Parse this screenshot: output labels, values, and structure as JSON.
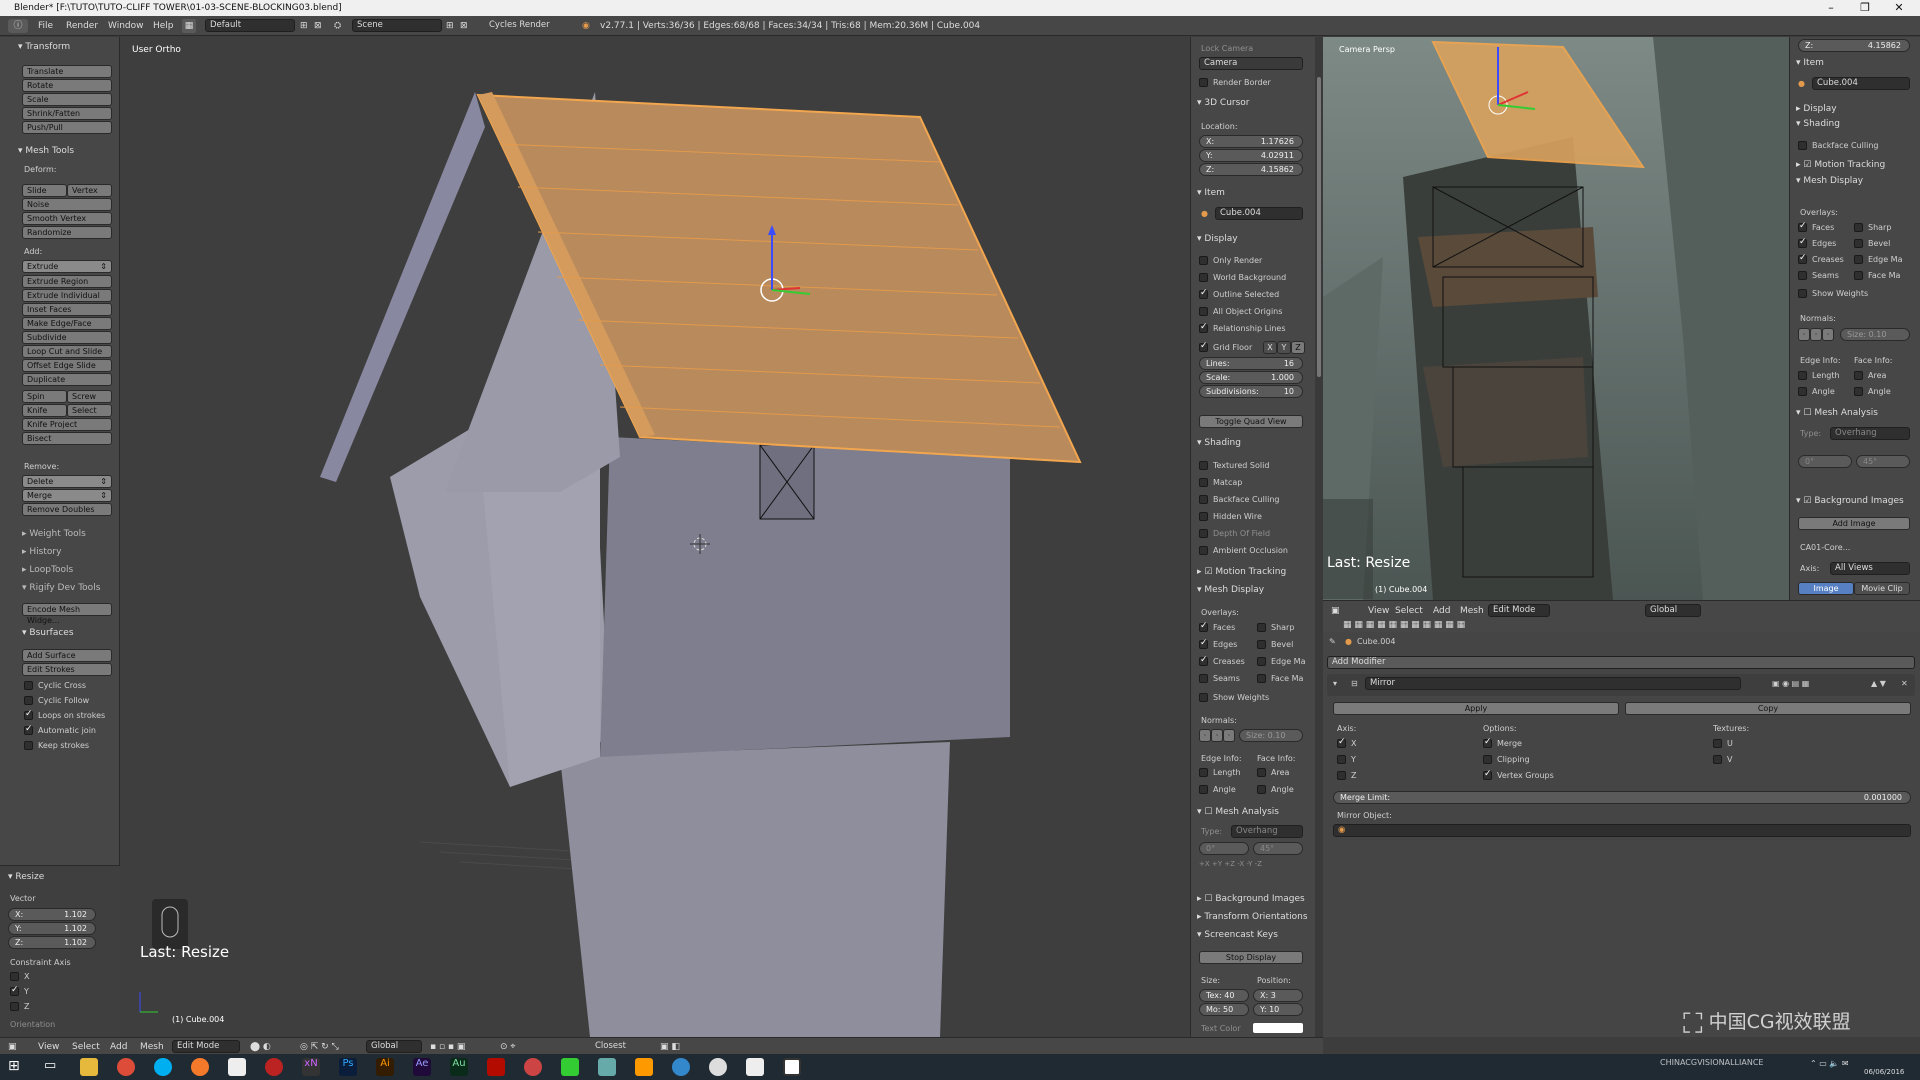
{
  "window": {
    "title": "Blender* [F:\\TUTO\\TUTO-CLIFF TOWER\\01-03-SCENE-BLOCKING03.blend]",
    "minimize": "–",
    "maximize": "❐",
    "close": "✕"
  },
  "menu": {
    "items": [
      "File",
      "Render",
      "Window",
      "Help"
    ],
    "layout": "Default",
    "scene": "Scene",
    "engine": "Cycles Render",
    "stats": "v2.77.1 | Verts:36/36 | Edges:68/68 | Faces:34/34 | Tris:68 | Mem:20.36M | Cube.004"
  },
  "toolshelf": {
    "transform_head": "Transform",
    "transform_buttons": [
      "Translate",
      "Rotate",
      "Scale",
      "Shrink/Fatten",
      "Push/Pull"
    ],
    "mesh_tools_head": "Mesh Tools",
    "deform_label": "Deform:",
    "slide_edge": "Slide Edge",
    "vertex": "Vertex",
    "deform_buttons": [
      "Noise",
      "Smooth Vertex",
      "Randomize"
    ],
    "add_label": "Add:",
    "extrude": "Extrude",
    "add_buttons": [
      "Extrude Region",
      "Extrude Individual",
      "Inset Faces",
      "Make Edge/Face",
      "Subdivide",
      "Loop Cut and Slide",
      "Offset Edge Slide",
      "Duplicate"
    ],
    "spin": "Spin",
    "screw": "Screw",
    "knife": "Knife",
    "select": "Select",
    "knife_project": "Knife Project",
    "bisect": "Bisect",
    "remove_label": "Remove:",
    "delete": "Delete",
    "merge": "Merge",
    "remove_doubles": "Remove Doubles",
    "collapsed": [
      "Weight Tools",
      "History",
      "LoopTools"
    ],
    "rigify_head": "Rigify Dev Tools",
    "encode_mesh": "Encode Mesh Widge...",
    "bsurfaces_head": "Bsurfaces",
    "add_surface": "Add Surface",
    "edit_strokes": "Edit Strokes",
    "bs_checks": [
      {
        "label": "Cyclic Cross",
        "on": false
      },
      {
        "label": "Cyclic Follow",
        "on": false
      },
      {
        "label": "Loops on strokes",
        "on": true
      },
      {
        "label": "Automatic join",
        "on": true
      },
      {
        "label": "Keep strokes",
        "on": false
      }
    ],
    "resize_head": "Resize",
    "vector_label": "Vector",
    "vector": [
      {
        "axis": "X:",
        "value": "1.102"
      },
      {
        "axis": "Y:",
        "value": "1.102"
      },
      {
        "axis": "Z:",
        "value": "1.102"
      }
    ],
    "constraint_label": "Constraint Axis",
    "constraint": [
      {
        "axis": "X",
        "on": false
      },
      {
        "axis": "Y",
        "on": true
      },
      {
        "axis": "Z",
        "on": false
      }
    ],
    "orientation_label": "Orientation"
  },
  "viewport": {
    "view_label": "User Ortho",
    "last_op": "Last: Resize",
    "object_label": "(1) Cube.004"
  },
  "npanel": {
    "lock_camera": "Lock Camera",
    "camera": "Camera",
    "render_border": "Render Border",
    "cursor_head": "3D Cursor",
    "location_label": "Location:",
    "cursor": [
      {
        "axis": "X:",
        "value": "1.17626"
      },
      {
        "axis": "Y:",
        "value": "4.02911"
      },
      {
        "axis": "Z:",
        "value": "4.15862"
      }
    ],
    "item_head": "Item",
    "item_name": "Cube.004",
    "display_head": "Display",
    "display_checks": [
      {
        "label": "Only Render",
        "on": false
      },
      {
        "label": "World Background",
        "on": false
      },
      {
        "label": "Outline Selected",
        "on": true
      },
      {
        "label": "All Object Origins",
        "on": false
      },
      {
        "label": "Relationship Lines",
        "on": true
      }
    ],
    "grid_floor": "Grid Floor",
    "grid_axes": [
      "X",
      "Y",
      "Z"
    ],
    "grid_fields": [
      {
        "label": "Lines:",
        "value": "16"
      },
      {
        "label": "Scale:",
        "value": "1.000"
      },
      {
        "label": "Subdivisions:",
        "value": "10"
      }
    ],
    "toggle_quad": "Toggle Quad View",
    "shading_head": "Shading",
    "shading_checks": [
      {
        "label": "Textured Solid",
        "on": false
      },
      {
        "label": "Matcap",
        "on": false
      },
      {
        "label": "Backface Culling",
        "on": false
      },
      {
        "label": "Hidden Wire",
        "on": false
      },
      {
        "label": "Depth Of Field",
        "on": false
      },
      {
        "label": "Ambient Occlusion",
        "on": false
      }
    ],
    "motion_tracking": "Motion Tracking",
    "mesh_display_head": "Mesh Display",
    "overlays_label": "Overlays:",
    "overlays": [
      {
        "label": "Faces",
        "on": true
      },
      {
        "label": "Sharp",
        "on": false
      },
      {
        "label": "Edges",
        "on": true
      },
      {
        "label": "Bevel",
        "on": false
      },
      {
        "label": "Creases",
        "on": true
      },
      {
        "label": "Edge Ma",
        "on": false
      },
      {
        "label": "Seams",
        "on": false
      },
      {
        "label": "Face Ma",
        "on": false
      }
    ],
    "show_weights": "Show Weights",
    "normals_label": "Normals:",
    "normals_size": "Size: 0.10",
    "edge_info": "Edge Info:",
    "face_info": "Face Info:",
    "info_checks": [
      {
        "label": "Length"
      },
      {
        "label": "Area"
      },
      {
        "label": "Angle"
      },
      {
        "label": "Angle"
      }
    ],
    "mesh_analysis": "Mesh Analysis",
    "ma_type_label": "Type:",
    "ma_type": "Overhang",
    "ma_min": "0°",
    "ma_max": "45°",
    "axis_buttons": [
      "+X",
      "+Y",
      "+Z",
      "-X",
      "-Y",
      "-Z"
    ],
    "bg_images": "Background Images",
    "transform_orient": "Transform Orientations",
    "screencast": "Screencast Keys",
    "stop_display": "Stop Display",
    "size_label": "Size:",
    "position_label": "Position:",
    "tex_field": "Tex: 40",
    "mo_field": "Mo: 50",
    "pos_x": "X: 3",
    "pos_y": "Y: 10",
    "text_color": "Text Color"
  },
  "camview": {
    "label": "Camera Persp",
    "last_op": "Last: Resize",
    "object_label": "(1) Cube.004"
  },
  "rpanel": {
    "z_field": "Z:",
    "z_value": "4.15862",
    "item_head": "Item",
    "item_name": "Cube.004",
    "display_head": "Display",
    "shading_head": "Shading",
    "backface": "Backface Culling",
    "motion_tracking": "Motion Tracking",
    "mesh_display_head": "Mesh Display",
    "overlays_label": "Overlays:",
    "overlays": [
      {
        "label": "Faces",
        "on": true
      },
      {
        "label": "Sharp",
        "on": false
      },
      {
        "label": "Edges",
        "on": true
      },
      {
        "label": "Bevel",
        "on": false
      },
      {
        "label": "Creases",
        "on": true
      },
      {
        "label": "Edge Ma",
        "on": false
      },
      {
        "label": "Seams",
        "on": false
      },
      {
        "label": "Face Ma",
        "on": false
      }
    ],
    "show_weights": "Show Weights",
    "normals_label": "Normals:",
    "normals_size": "Size: 0.10",
    "edge_info": "Edge Info:",
    "face_info": "Face Info:",
    "length": "Length",
    "area": "Area",
    "angle1": "Angle",
    "angle2": "Angle",
    "mesh_analysis": "Mesh Analysis",
    "ma_type_label": "Type:",
    "ma_type": "Overhang",
    "ma_min": "0°",
    "ma_max": "45°",
    "bg_images": "Background Images",
    "add_image": "Add Image",
    "image_entry": "CA01-Core...",
    "axis_label": "Axis:",
    "axis_value": "All Views",
    "image_tab": "Image",
    "movie_tab": "Movie Clip"
  },
  "midheader": {
    "items": [
      "View",
      "Select",
      "Add",
      "Mesh"
    ],
    "mode": "Edit Mode",
    "orientation": "Global"
  },
  "props": {
    "object": "Cube.004",
    "add_modifier": "Add Modifier",
    "modifier_name": "Mirror",
    "apply": "Apply",
    "copy": "Copy",
    "axis_label": "Axis:",
    "options_label": "Options:",
    "textures_label": "Textures:",
    "axes": [
      {
        "label": "X",
        "on": true
      },
      {
        "label": "Y",
        "on": false
      },
      {
        "label": "Z",
        "on": false
      }
    ],
    "options": [
      {
        "label": "Merge",
        "on": true
      },
      {
        "label": "Clipping",
        "on": false
      },
      {
        "label": "Vertex Groups",
        "on": true
      }
    ],
    "textures": [
      {
        "label": "U",
        "on": false
      },
      {
        "label": "V",
        "on": false
      }
    ],
    "merge_limit_label": "Merge Limit:",
    "merge_limit": "0.001000",
    "mirror_object": "Mirror Object:"
  },
  "bottomheader": {
    "items": [
      "View",
      "Select",
      "Add",
      "Mesh"
    ],
    "mode": "Edit Mode",
    "orientation": "Global",
    "snap": "Closest"
  },
  "taskbar": {
    "clock_time": "",
    "clock_date": "06/06/2016"
  },
  "watermark": {
    "main": "中国CG视效联盟",
    "sub": "CHINACGVISIONALLIANCE"
  },
  "colors": {
    "selection_orange": "#e39a4c",
    "viewport_bg": "#3e3e3e",
    "panel_bg": "#474747"
  }
}
